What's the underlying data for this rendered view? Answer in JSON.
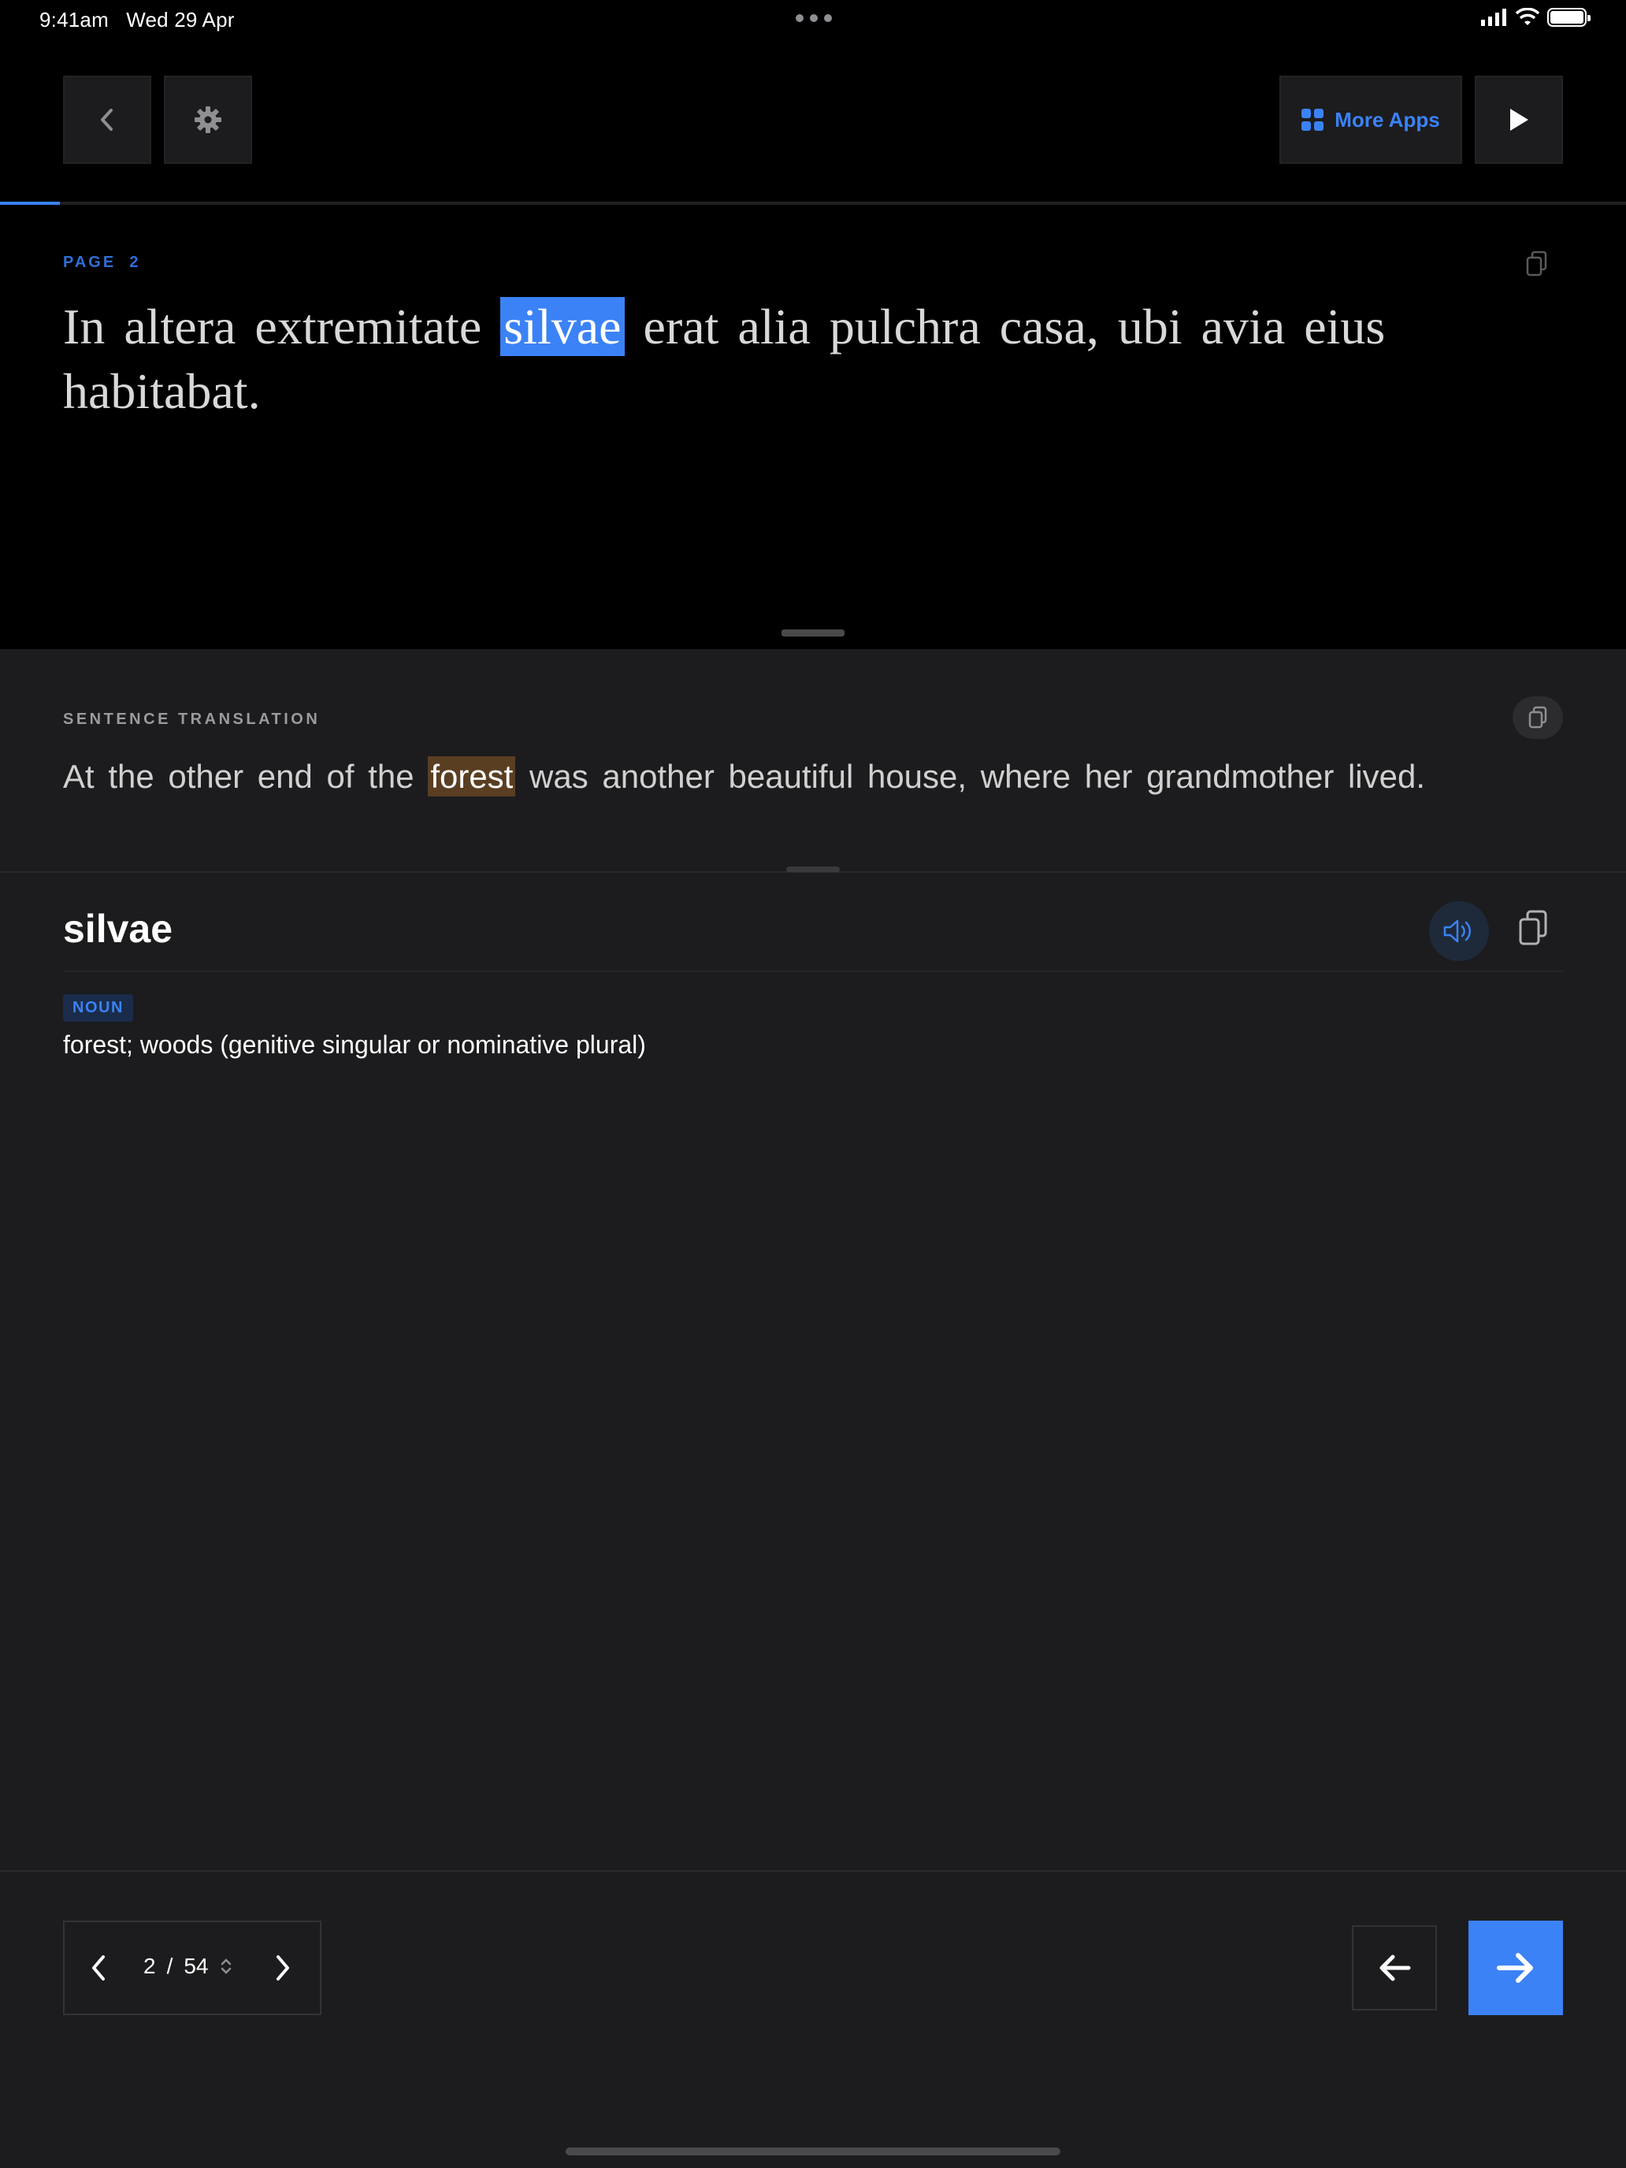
{
  "status_bar": {
    "time": "9:41am",
    "date": "Wed 29 Apr"
  },
  "header": {
    "more_apps_label": "More Apps",
    "progress_fraction": 0.037
  },
  "reader": {
    "page_label": "PAGE",
    "page_number": "2",
    "text_before": "In altera extremitate ",
    "highlighted_word": "silvae",
    "text_after": " erat alia pulchra casa, ubi avia eius habitabat."
  },
  "translation": {
    "section_label": "SENTENCE TRANSLATION",
    "text_before": "At the other end of the ",
    "highlighted_word": "forest",
    "text_after": " was another beautiful house, where her grandmother lived."
  },
  "dictionary": {
    "word": "silvae",
    "part_of_speech": "NOUN",
    "definition": "forest; woods (genitive singular or nominative plural)"
  },
  "pager": {
    "current": "2",
    "separator": "/",
    "total": "54"
  },
  "colors": {
    "accent": "#3b82f6",
    "highlight_translation": "#5a3e22",
    "background": "#1c1c1e"
  },
  "icons": [
    "chevron-left-icon",
    "gear-icon",
    "grid-icon",
    "play-icon",
    "copy-icon",
    "speaker-icon",
    "arrow-left-icon",
    "arrow-right-icon",
    "chevron-right-icon",
    "updown-icon"
  ]
}
